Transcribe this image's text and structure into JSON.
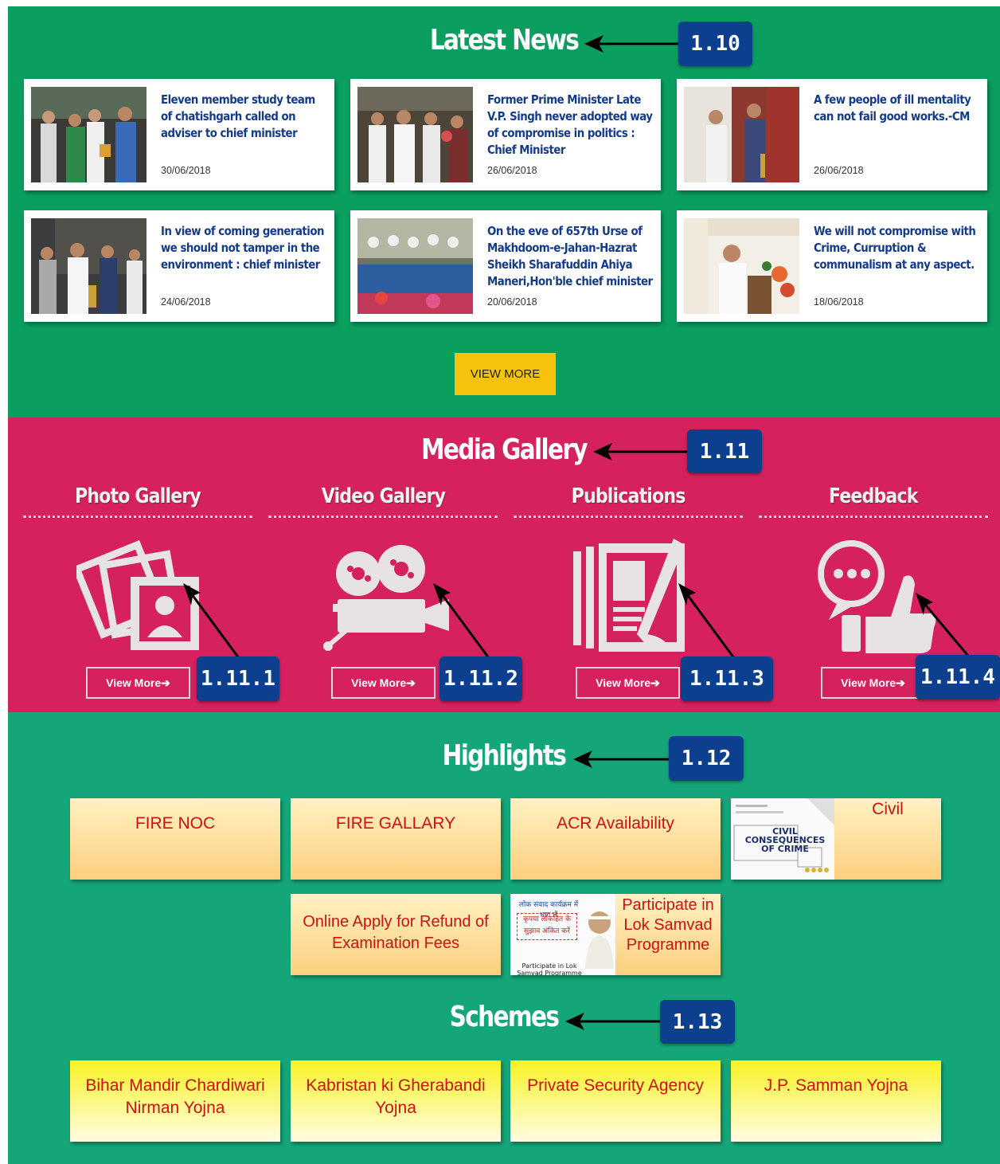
{
  "news": {
    "title": "Latest News",
    "badge": "1.10",
    "items": [
      {
        "title": "Eleven member study team of chatishgarh called on adviser to chief minister",
        "date": "30/06/2018"
      },
      {
        "title": "Former Prime Minister Late V.P. Singh never adopted way of compromise in politics : Chief Minister",
        "date": "26/06/2018"
      },
      {
        "title": "A few people of ill mentality can not fail good works.-CM",
        "date": "26/06/2018"
      },
      {
        "title": "In view of coming generation we should not tamper in the environment : chief minister",
        "date": "24/06/2018"
      },
      {
        "title": "On the eve of 657th Urse of Makhdoom-e-Jahan-Hazrat Sheikh Sharafuddin Ahiya Maneri,Hon'ble chief minister",
        "date": "20/06/2018"
      },
      {
        "title": "We will not compromise with Crime, Curruption & communalism at any aspect.",
        "date": "18/06/2018"
      }
    ],
    "view_more": "VIEW MORE"
  },
  "media": {
    "title": "Media Gallery",
    "badge": "1.11",
    "galleries": [
      {
        "label": "Photo Gallery",
        "button": "View More➔",
        "badge": "1.11.1",
        "icon": "photo-gallery-icon"
      },
      {
        "label": "Video Gallery",
        "button": "View More➔",
        "badge": "1.11.2",
        "icon": "video-camera-icon"
      },
      {
        "label": "Publications",
        "button": "View More➔",
        "badge": "1.11.3",
        "icon": "publications-icon"
      },
      {
        "label": "Feedback",
        "button": "View More➔",
        "badge": "1.11.4",
        "icon": "feedback-icon"
      }
    ]
  },
  "highlights": {
    "title": "Highlights",
    "badge": "1.12",
    "items": [
      {
        "label": "FIRE NOC"
      },
      {
        "label": "FIRE GALLARY"
      },
      {
        "label": "ACR Availability"
      },
      {
        "label": "Civil",
        "image_text": "CIVIL CONSEQUENCES OF CRIME"
      },
      {
        "label": "Online Apply for Refund of Examination Fees"
      },
      {
        "label": "Participate in Lok Samvad Programme",
        "image_text_1": "लोक संवाद कार्यक्रम में भाग लें",
        "image_text_2": "कृपया लोकहित के सुझाव अंकित करें",
        "image_text_3": "Participate in Lok Samvad Programme"
      }
    ]
  },
  "schemes": {
    "title": "Schemes",
    "badge": "1.13",
    "items": [
      {
        "label": "Bihar Mandir Chardiwari Nirman Yojna"
      },
      {
        "label": "Kabristan ki Gherabandi Yojna"
      },
      {
        "label": "Private Security Agency"
      },
      {
        "label": "J.P. Samman Yojna"
      }
    ]
  },
  "colors": {
    "news_bg": "#0a9e5f",
    "media_bg": "#d5215d",
    "highlights_bg": "#14a679",
    "badge_bg": "#0d3f8f",
    "news_title_text": "#143b8a",
    "button_yellow": "#f6c20d",
    "highlight_text": "#cc1212"
  }
}
